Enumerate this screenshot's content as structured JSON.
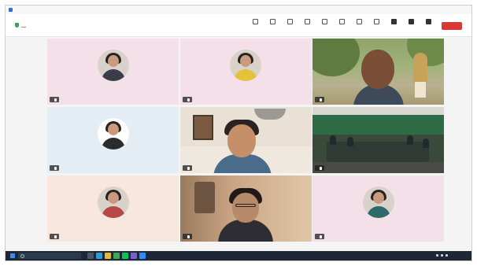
{
  "window": {
    "title": ""
  },
  "toolbar": {
    "left_text": "",
    "tools": [
      {
        "icon": "participants-icon",
        "label": ""
      },
      {
        "icon": "chat-icon",
        "label": ""
      },
      {
        "icon": "share-icon",
        "label": ""
      },
      {
        "icon": "record-icon",
        "label": ""
      },
      {
        "icon": "reactions-icon",
        "label": ""
      },
      {
        "icon": "apps-icon",
        "label": ""
      },
      {
        "icon": "whiteboard-icon",
        "label": ""
      },
      {
        "icon": "more-icon",
        "label": ""
      },
      {
        "icon": "camera-icon",
        "label": ""
      },
      {
        "icon": "microphone-icon",
        "label": ""
      },
      {
        "icon": "share-screen-icon",
        "label": ""
      }
    ],
    "leave_label": ""
  },
  "participants": [
    {
      "name": "",
      "type": "avatar",
      "bg": "pink"
    },
    {
      "name": "",
      "type": "avatar",
      "bg": "pink"
    },
    {
      "name": "",
      "type": "video-outdoor"
    },
    {
      "name": "",
      "type": "avatar",
      "bg": "blue"
    },
    {
      "name": "",
      "type": "video-office"
    },
    {
      "name": "",
      "type": "video-room"
    },
    {
      "name": "",
      "type": "avatar",
      "bg": "peach"
    },
    {
      "name": "",
      "type": "video-desk"
    },
    {
      "name": "",
      "type": "avatar",
      "bg": "pink"
    }
  ],
  "taskbar": {
    "search_placeholder": "",
    "time": "",
    "date": ""
  },
  "colors": {
    "leave_button": "#d93636",
    "taskbar": "#1d2735",
    "accent": "#1f6fe5"
  }
}
